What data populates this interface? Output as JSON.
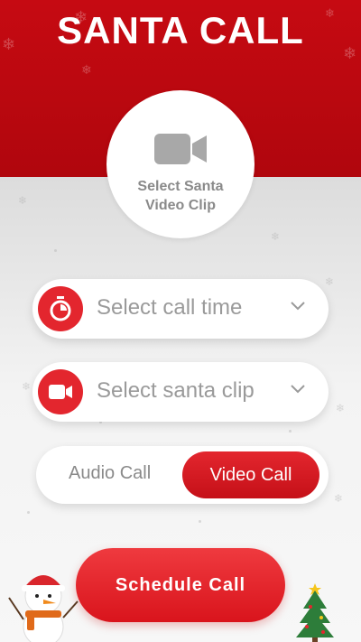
{
  "header": {
    "title": "SANTA CALL"
  },
  "video_clip_picker": {
    "label": "Select Santa Video Clip",
    "icon": "video-camera-icon"
  },
  "call_time_select": {
    "placeholder": "Select call time",
    "icon": "stopwatch-icon"
  },
  "santa_clip_select": {
    "placeholder": "Select santa clip",
    "icon": "video-camera-icon"
  },
  "call_type_toggle": {
    "options": [
      "Audio Call",
      "Video Call"
    ],
    "selected": "Video Call"
  },
  "schedule_button": {
    "label": "Schedule Call"
  },
  "colors": {
    "primary_red": "#e3262e",
    "header_red": "#c60a12",
    "placeholder_grey": "#9a9a9a"
  }
}
